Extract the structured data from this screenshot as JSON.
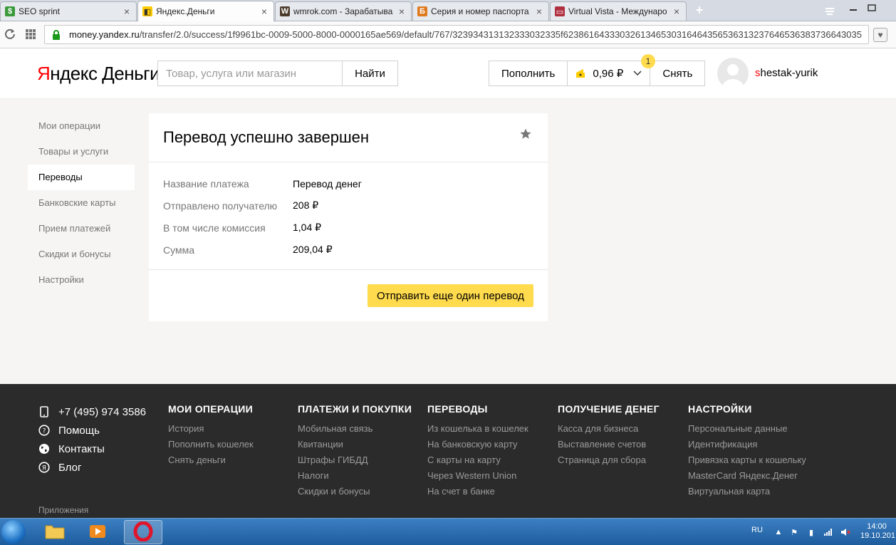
{
  "browser": {
    "tabs": [
      {
        "label": "SEO sprint",
        "icon": "dollar-icon"
      },
      {
        "label": "Яндекс.Деньги",
        "icon": "wallet-icon"
      },
      {
        "label": "wmrok.com - Зарабатыва",
        "icon": "w-icon"
      },
      {
        "label": "Серия и номер паспорта",
        "icon": "b-icon"
      },
      {
        "label": "Virtual Vista - Междунаро",
        "icon": "card-icon"
      }
    ],
    "new_tab": "+",
    "url_host": "money.yandex.ru",
    "url_path": "/transfer/2.0/success/1f9961bc-0009-5000-8000-0000165ae569/default/767/32393431313233303233​5f623861643330326134653031646435653631323764653638373664303​5"
  },
  "header": {
    "logo_y": "Я",
    "logo_rest": "ндекс Деньги",
    "search_placeholder": "Товар, услуга или магазин",
    "search_button": "Найти",
    "topup": "Пополнить",
    "balance": "0,96 ₽",
    "withdraw": "Снять",
    "notifications": "1",
    "user_first": "s",
    "user_rest": "hestak-yurik"
  },
  "sidebar": {
    "items": [
      {
        "label": "Мои операции"
      },
      {
        "label": "Товары и услуги"
      },
      {
        "label": "Переводы"
      },
      {
        "label": "Банковские карты"
      },
      {
        "label": "Прием платежей"
      },
      {
        "label": "Скидки и бонусы"
      },
      {
        "label": "Настройки"
      }
    ],
    "active_index": 2
  },
  "main": {
    "title": "Перевод успешно завершен",
    "details": [
      {
        "key": "Название платежа",
        "value": "Перевод денег"
      },
      {
        "key": "Отправлено получателю",
        "value": "208 ₽"
      },
      {
        "key": "В том числе комиссия",
        "value": "1,04 ₽"
      },
      {
        "key": "Сумма",
        "value": "209,04 ₽"
      }
    ],
    "action": "Отправить еще один перевод"
  },
  "footer": {
    "contacts": [
      {
        "icon": "phone-icon",
        "label": "+7 (495) 974 3586"
      },
      {
        "icon": "help-icon",
        "label": "Помощь"
      },
      {
        "icon": "globe-icon",
        "label": "Контакты"
      },
      {
        "icon": "blog-icon",
        "label": "Блог"
      }
    ],
    "columns": [
      {
        "title": "МОИ ОПЕРАЦИИ",
        "links": [
          "История",
          "Пополнить кошелек",
          "Снять деньги"
        ]
      },
      {
        "title": "ПЛАТЕЖИ И ПОКУПКИ",
        "links": [
          "Мобильная связь",
          "Квитанции",
          "Штрафы ГИБДД",
          "Налоги",
          "Скидки и бонусы"
        ]
      },
      {
        "title": "ПЕРЕВОДЫ",
        "links": [
          "Из кошелька в кошелек",
          "На банковскую карту",
          "С карты на карту",
          "Через Western Union",
          "На счет в банке"
        ]
      },
      {
        "title": "ПОЛУЧЕНИЕ ДЕНЕГ",
        "links": [
          "Касса для бизнеса",
          "Выставление счетов",
          "Страница для сбора"
        ]
      },
      {
        "title": "НАСТРОЙКИ",
        "links": [
          "Персональные данные",
          "Идентификация",
          "Привязка карты к кошельку",
          "MasterCard Яндекс.Денег",
          "Виртуальная карта"
        ]
      }
    ],
    "apps_label": "Приложения"
  },
  "taskbar": {
    "lang": "RU",
    "time": "14:00",
    "date": "19.10.201"
  },
  "colors": {
    "accent": "#ffdb4d",
    "brand_red": "#ff0000",
    "footer_bg": "#2b2b2b"
  }
}
